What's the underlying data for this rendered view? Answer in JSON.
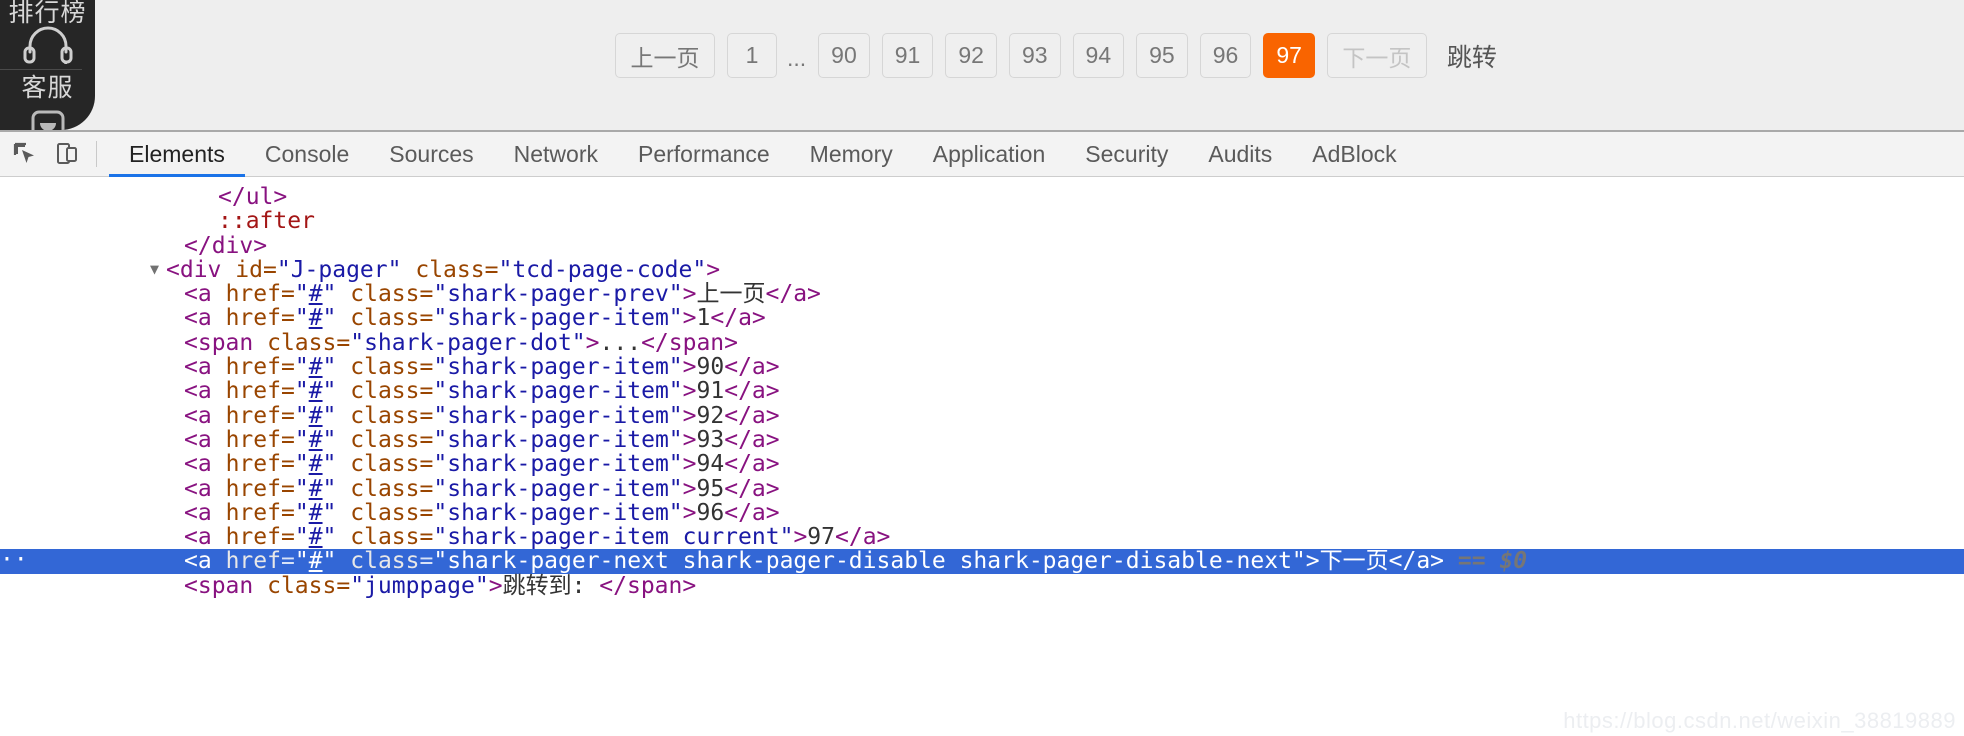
{
  "side_widget": {
    "top_label": "排行榜",
    "headset_icon": "headset-icon",
    "mid_label": "客服",
    "robot_icon": "robot-icon"
  },
  "pagination": {
    "prev_label": "上一页",
    "first_page": "1",
    "ellipsis": "...",
    "pages": [
      "90",
      "91",
      "92",
      "93",
      "94",
      "95",
      "96"
    ],
    "current_page": "97",
    "next_label": "下一页",
    "jump_label": "跳转",
    "accent_color": "#f96400",
    "button_bg": "#efefef",
    "button_border": "#d6d6d6",
    "button_text": "#777777",
    "disabled_text": "#c4c4c4"
  },
  "devtools": {
    "inspect_icon": "inspect-element-icon",
    "device_toolbar_icon": "device-toolbar-icon",
    "tabs": [
      {
        "label": "Elements",
        "active": true
      },
      {
        "label": "Console",
        "active": false
      },
      {
        "label": "Sources",
        "active": false
      },
      {
        "label": "Network",
        "active": false
      },
      {
        "label": "Performance",
        "active": false
      },
      {
        "label": "Memory",
        "active": false
      },
      {
        "label": "Application",
        "active": false
      },
      {
        "label": "Security",
        "active": false
      },
      {
        "label": "Audits",
        "active": false
      },
      {
        "label": "AdBlock",
        "active": false
      }
    ],
    "active_tab_underline": "#1a73e8",
    "selection_bg": "#3367d6"
  },
  "dom": {
    "lines": [
      {
        "indent": 2,
        "type": "close",
        "tag": "ul"
      },
      {
        "indent": 2,
        "type": "pseudo",
        "text": "::after"
      },
      {
        "indent": 1,
        "type": "close",
        "tag": "div"
      },
      {
        "indent": 0,
        "type": "open",
        "twisty": true,
        "tag": "div",
        "attrs": [
          {
            "name": "id",
            "value": "J-pager"
          },
          {
            "name": "class",
            "value": "tcd-page-code"
          }
        ]
      },
      {
        "indent": 1,
        "type": "inline",
        "tag": "a",
        "attrs": [
          {
            "name": "href",
            "value": "#",
            "link": true
          },
          {
            "name": "class",
            "value": "shark-pager-prev"
          }
        ],
        "text": "上一页"
      },
      {
        "indent": 1,
        "type": "inline",
        "tag": "a",
        "attrs": [
          {
            "name": "href",
            "value": "#",
            "link": true
          },
          {
            "name": "class",
            "value": "shark-pager-item"
          }
        ],
        "text": "1"
      },
      {
        "indent": 1,
        "type": "inline",
        "tag": "span",
        "attrs": [
          {
            "name": "class",
            "value": "shark-pager-dot"
          }
        ],
        "text": "..."
      },
      {
        "indent": 1,
        "type": "inline",
        "tag": "a",
        "attrs": [
          {
            "name": "href",
            "value": "#",
            "link": true
          },
          {
            "name": "class",
            "value": "shark-pager-item"
          }
        ],
        "text": "90"
      },
      {
        "indent": 1,
        "type": "inline",
        "tag": "a",
        "attrs": [
          {
            "name": "href",
            "value": "#",
            "link": true
          },
          {
            "name": "class",
            "value": "shark-pager-item"
          }
        ],
        "text": "91"
      },
      {
        "indent": 1,
        "type": "inline",
        "tag": "a",
        "attrs": [
          {
            "name": "href",
            "value": "#",
            "link": true
          },
          {
            "name": "class",
            "value": "shark-pager-item"
          }
        ],
        "text": "92"
      },
      {
        "indent": 1,
        "type": "inline",
        "tag": "a",
        "attrs": [
          {
            "name": "href",
            "value": "#",
            "link": true
          },
          {
            "name": "class",
            "value": "shark-pager-item"
          }
        ],
        "text": "93"
      },
      {
        "indent": 1,
        "type": "inline",
        "tag": "a",
        "attrs": [
          {
            "name": "href",
            "value": "#",
            "link": true
          },
          {
            "name": "class",
            "value": "shark-pager-item"
          }
        ],
        "text": "94"
      },
      {
        "indent": 1,
        "type": "inline",
        "tag": "a",
        "attrs": [
          {
            "name": "href",
            "value": "#",
            "link": true
          },
          {
            "name": "class",
            "value": "shark-pager-item"
          }
        ],
        "text": "95"
      },
      {
        "indent": 1,
        "type": "inline",
        "tag": "a",
        "attrs": [
          {
            "name": "href",
            "value": "#",
            "link": true
          },
          {
            "name": "class",
            "value": "shark-pager-item"
          }
        ],
        "text": "96"
      },
      {
        "indent": 1,
        "type": "inline",
        "tag": "a",
        "attrs": [
          {
            "name": "href",
            "value": "#",
            "link": true
          },
          {
            "name": "class",
            "value": "shark-pager-item current"
          }
        ],
        "text": "97"
      },
      {
        "indent": 1,
        "type": "inline",
        "tag": "a",
        "selected": true,
        "attrs": [
          {
            "name": "href",
            "value": "#",
            "link": true
          },
          {
            "name": "class",
            "value": "shark-pager-next shark-pager-disable shark-pager-disable-next"
          }
        ],
        "text": "下一页",
        "suffix": "== $0"
      },
      {
        "indent": 1,
        "type": "inline",
        "tag": "span",
        "attrs": [
          {
            "name": "class",
            "value": "jumppage"
          }
        ],
        "text": "跳转到: "
      }
    ]
  },
  "watermark": "https://blog.csdn.net/weixin_38819889"
}
